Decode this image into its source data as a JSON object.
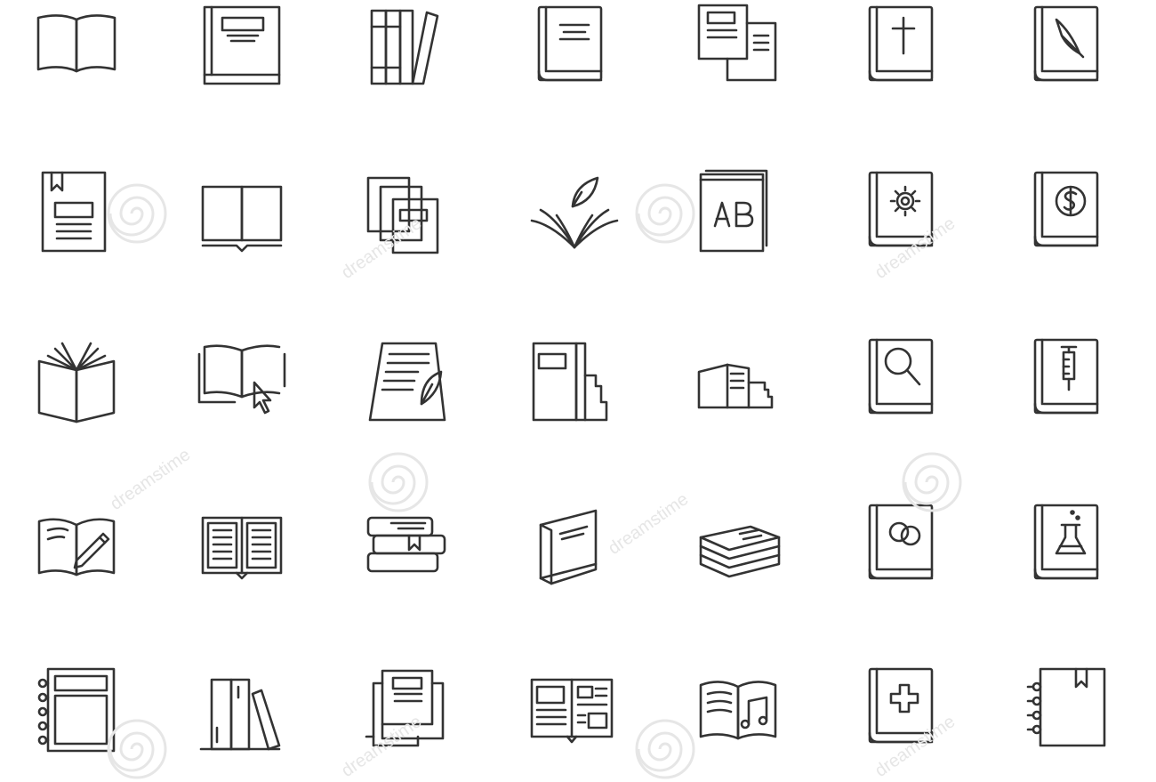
{
  "stroke_color": "#333333",
  "watermark_color": "#e6e6e6",
  "rows": [
    [
      "open-book-icon",
      "book-cover-text-icon",
      "books-on-shelf-icon",
      "closed-book-icon",
      "two-documents-icon",
      "bible-icon",
      "quill-book-icon"
    ],
    [
      "bookmarked-book-icon",
      "open-book-flat-icon",
      "stacked-documents-icon",
      "quill-leaves-icon",
      "alphabet-book-icon",
      "settings-book-icon",
      "finance-book-icon"
    ],
    [
      "open-book-pages-icon",
      "open-book-cursor-icon",
      "writing-page-icon",
      "binder-books-icon",
      "book-stack-reading-icon",
      "search-book-icon",
      "medical-syringe-book-icon"
    ],
    [
      "open-book-pen-icon",
      "open-book-text-icon",
      "three-books-stack-icon",
      "standing-book-icon",
      "stacked-books-icon",
      "wedding-rings-book-icon",
      "science-flask-book-icon"
    ],
    [
      "spiral-notebook-icon",
      "books-on-shelf-leaning-icon",
      "document-stack-icon",
      "magazine-icon",
      "music-book-icon",
      "medical-cross-book-icon",
      "spiral-bookmark-notebook-icon"
    ]
  ],
  "watermark": {
    "text": "dreamstime"
  }
}
